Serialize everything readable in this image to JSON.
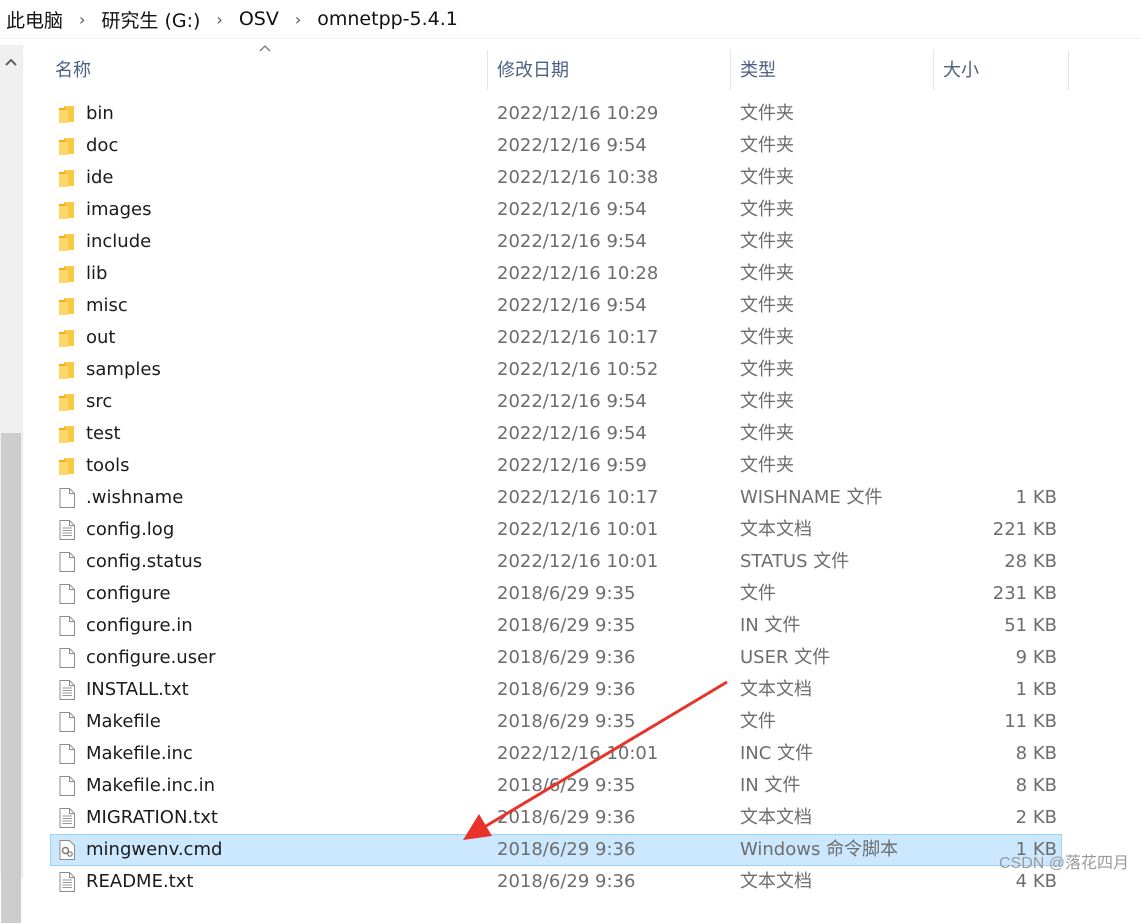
{
  "breadcrumb": [
    "此电脑",
    "研究生 (G:)",
    "OSV",
    "omnetpp-5.4.1"
  ],
  "columns": {
    "name": "名称",
    "date": "修改日期",
    "type": "类型",
    "size": "大小"
  },
  "files": [
    {
      "name": "bin",
      "date": "2022/12/16 10:29",
      "type": "文件夹",
      "size": "",
      "icon": "folder-icon"
    },
    {
      "name": "doc",
      "date": "2022/12/16 9:54",
      "type": "文件夹",
      "size": "",
      "icon": "folder-icon"
    },
    {
      "name": "ide",
      "date": "2022/12/16 10:38",
      "type": "文件夹",
      "size": "",
      "icon": "folder-icon"
    },
    {
      "name": "images",
      "date": "2022/12/16 9:54",
      "type": "文件夹",
      "size": "",
      "icon": "folder-icon"
    },
    {
      "name": "include",
      "date": "2022/12/16 9:54",
      "type": "文件夹",
      "size": "",
      "icon": "folder-icon"
    },
    {
      "name": "lib",
      "date": "2022/12/16 10:28",
      "type": "文件夹",
      "size": "",
      "icon": "folder-icon"
    },
    {
      "name": "misc",
      "date": "2022/12/16 9:54",
      "type": "文件夹",
      "size": "",
      "icon": "folder-icon"
    },
    {
      "name": "out",
      "date": "2022/12/16 10:17",
      "type": "文件夹",
      "size": "",
      "icon": "folder-icon"
    },
    {
      "name": "samples",
      "date": "2022/12/16 10:52",
      "type": "文件夹",
      "size": "",
      "icon": "folder-icon"
    },
    {
      "name": "src",
      "date": "2022/12/16 9:54",
      "type": "文件夹",
      "size": "",
      "icon": "folder-icon"
    },
    {
      "name": "test",
      "date": "2022/12/16 9:54",
      "type": "文件夹",
      "size": "",
      "icon": "folder-icon"
    },
    {
      "name": "tools",
      "date": "2022/12/16 9:59",
      "type": "文件夹",
      "size": "",
      "icon": "folder-icon"
    },
    {
      "name": ".wishname",
      "date": "2022/12/16 10:17",
      "type": "WISHNAME 文件",
      "size": "1 KB",
      "icon": "blank-file-icon"
    },
    {
      "name": "config.log",
      "date": "2022/12/16 10:01",
      "type": "文本文档",
      "size": "221 KB",
      "icon": "text-file-icon"
    },
    {
      "name": "config.status",
      "date": "2022/12/16 10:01",
      "type": "STATUS 文件",
      "size": "28 KB",
      "icon": "blank-file-icon"
    },
    {
      "name": "configure",
      "date": "2018/6/29 9:35",
      "type": "文件",
      "size": "231 KB",
      "icon": "blank-file-icon"
    },
    {
      "name": "configure.in",
      "date": "2018/6/29 9:35",
      "type": "IN 文件",
      "size": "51 KB",
      "icon": "blank-file-icon"
    },
    {
      "name": "configure.user",
      "date": "2018/6/29 9:36",
      "type": "USER 文件",
      "size": "9 KB",
      "icon": "blank-file-icon"
    },
    {
      "name": "INSTALL.txt",
      "date": "2018/6/29 9:36",
      "type": "文本文档",
      "size": "1 KB",
      "icon": "text-file-icon"
    },
    {
      "name": "Makefile",
      "date": "2018/6/29 9:35",
      "type": "文件",
      "size": "11 KB",
      "icon": "blank-file-icon"
    },
    {
      "name": "Makefile.inc",
      "date": "2022/12/16 10:01",
      "type": "INC 文件",
      "size": "8 KB",
      "icon": "blank-file-icon"
    },
    {
      "name": "Makefile.inc.in",
      "date": "2018/6/29 9:35",
      "type": "IN 文件",
      "size": "8 KB",
      "icon": "blank-file-icon"
    },
    {
      "name": "MIGRATION.txt",
      "date": "2018/6/29 9:36",
      "type": "文本文档",
      "size": "2 KB",
      "icon": "text-file-icon"
    },
    {
      "name": "mingwenv.cmd",
      "date": "2018/6/29 9:36",
      "type": "Windows 命令脚本",
      "size": "1 KB",
      "icon": "cmd-script-icon",
      "selected": true
    },
    {
      "name": "README.txt",
      "date": "2018/6/29 9:36",
      "type": "文本文档",
      "size": "4 KB",
      "icon": "text-file-icon"
    }
  ],
  "watermark": "CSDN @落花四月",
  "colors": {
    "selection": "#cce8ff",
    "selection_border": "#99d1ff",
    "header_text": "#4d6082",
    "folder": "#f7c948",
    "annotation_arrow": "#e8332a"
  }
}
